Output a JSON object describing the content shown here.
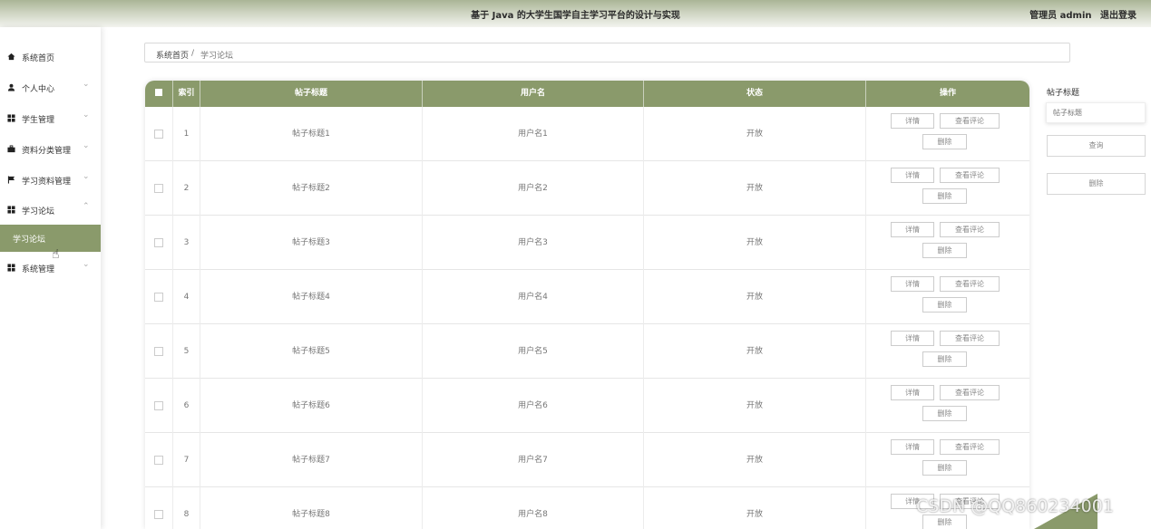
{
  "header": {
    "title": "基于 Java 的大学生国学自主学习平台的设计与实现",
    "user_label": "管理员 admin",
    "logout_label": "退出登录"
  },
  "sidebar": {
    "items": [
      {
        "label": "系统首页",
        "icon": "home-icon"
      },
      {
        "label": "个人中心",
        "icon": "person-icon",
        "chevron": "⌄"
      },
      {
        "label": "学生管理",
        "icon": "grid-icon",
        "chevron": "⌄"
      },
      {
        "label": "资料分类管理",
        "icon": "briefcase-icon",
        "chevron": "⌄"
      },
      {
        "label": "学习资料管理",
        "icon": "flag-icon",
        "chevron": "⌄"
      },
      {
        "label": "学习论坛",
        "icon": "grid-icon",
        "chevron": "⌃"
      },
      {
        "label": "系统管理",
        "icon": "grid-icon",
        "chevron": "⌄"
      }
    ],
    "active_sub": "学习论坛"
  },
  "breadcrumb": {
    "home": "系统首页",
    "sep": "/",
    "current": "学习论坛"
  },
  "table": {
    "columns": [
      "索引",
      "帖子标题",
      "用户名",
      "状态",
      "操作"
    ],
    "rows": [
      {
        "index": "1",
        "title": "帖子标题1",
        "user": "用户名1",
        "status": "开放"
      },
      {
        "index": "2",
        "title": "帖子标题2",
        "user": "用户名2",
        "status": "开放"
      },
      {
        "index": "3",
        "title": "帖子标题3",
        "user": "用户名3",
        "status": "开放"
      },
      {
        "index": "4",
        "title": "帖子标题4",
        "user": "用户名4",
        "status": "开放"
      },
      {
        "index": "5",
        "title": "帖子标题5",
        "user": "用户名5",
        "status": "开放"
      },
      {
        "index": "6",
        "title": "帖子标题6",
        "user": "用户名6",
        "status": "开放"
      },
      {
        "index": "7",
        "title": "帖子标题7",
        "user": "用户名7",
        "status": "开放"
      },
      {
        "index": "8",
        "title": "帖子标题8",
        "user": "用户名8",
        "status": "开放"
      }
    ],
    "actions": {
      "detail": "详情",
      "comments": "查看评论",
      "delete": "删除"
    }
  },
  "search": {
    "label": "帖子标题",
    "placeholder": "帖子标题",
    "search_button": "查询",
    "delete_button": "删除"
  },
  "watermark": "CSDN @QQ860234001",
  "colors": {
    "accent": "#8a9a6b",
    "header_top": "#aab596"
  }
}
